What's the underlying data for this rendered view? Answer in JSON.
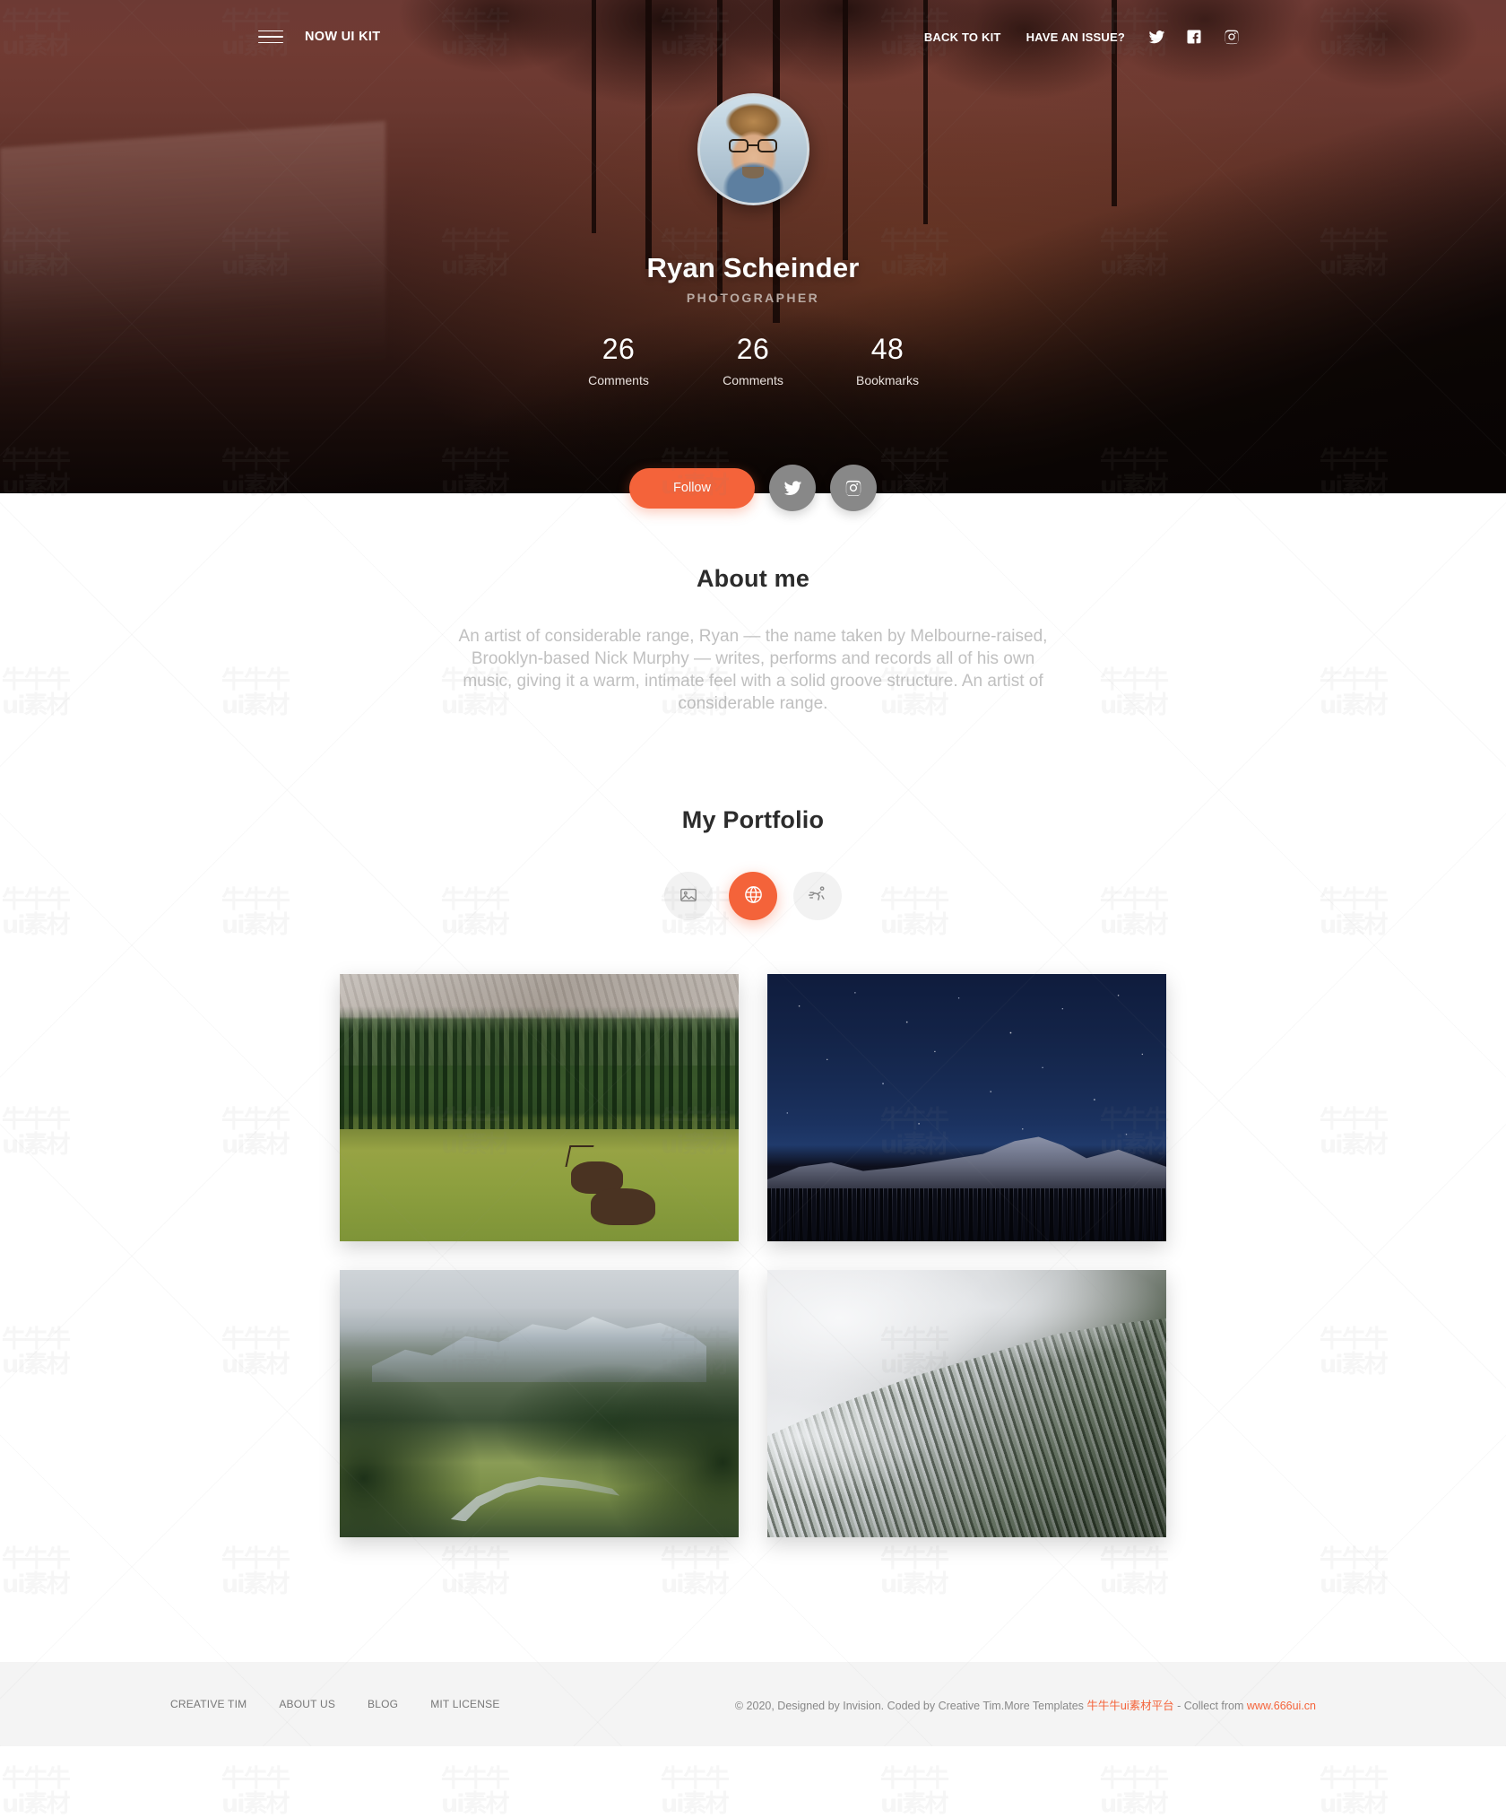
{
  "navbar": {
    "brand": "NOW UI KIT",
    "menu_icon": "hamburger-icon",
    "links": [
      {
        "label": "BACK TO KIT"
      },
      {
        "label": "HAVE AN ISSUE?"
      }
    ],
    "social_icons": [
      {
        "name": "twitter-icon"
      },
      {
        "name": "facebook-icon"
      },
      {
        "name": "instagram-icon"
      }
    ]
  },
  "hero": {
    "avatar_alt": "avatar",
    "name": "Ryan Scheinder",
    "role": "PHOTOGRAPHER",
    "stats": [
      {
        "value": "26",
        "label": "Comments"
      },
      {
        "value": "26",
        "label": "Comments"
      },
      {
        "value": "48",
        "label": "Bookmarks"
      }
    ]
  },
  "actions": {
    "follow_label": "Follow",
    "twitter_icon": "twitter-icon",
    "instagram_icon": "instagram-icon"
  },
  "about": {
    "title": "About me",
    "text": "An artist of considerable range, Ryan — the name taken by Melbourne-raised, Brooklyn-based Nick Murphy — writes, performs and records all of his own music, giving it a warm, intimate feel with a solid groove structure. An artist of considerable range."
  },
  "portfolio": {
    "title": "My Portfolio",
    "filters": [
      {
        "name": "image-icon",
        "active": false
      },
      {
        "name": "palette-icon",
        "active": true
      },
      {
        "name": "runner-icon",
        "active": false
      }
    ],
    "photos": [
      {
        "alt": "Yosemite valley meadow with deer and pine forest"
      },
      {
        "alt": "Starry night sky over granite mountain ridge"
      },
      {
        "alt": "Green alpine valley with winding river"
      },
      {
        "alt": "Misty snow-dusted forested mountain slope"
      }
    ]
  },
  "footer": {
    "links": [
      {
        "label": "CREATIVE TIM"
      },
      {
        "label": "ABOUT US"
      },
      {
        "label": "BLOG"
      },
      {
        "label": "MIT LICENSE"
      }
    ],
    "copyright_prefix": "© 2020, Designed by Invision. Coded by Creative Tim.More Templates ",
    "copyright_link1": "牛牛牛ui素材平台",
    "copyright_middle": " - Collect from ",
    "copyright_link2": "www.666ui.cn"
  },
  "colors": {
    "accent": "#f4633a",
    "hero_dark": "#3a1d18",
    "muted_text": "#c0c0c0",
    "footer_bg": "#f4f4f4"
  }
}
